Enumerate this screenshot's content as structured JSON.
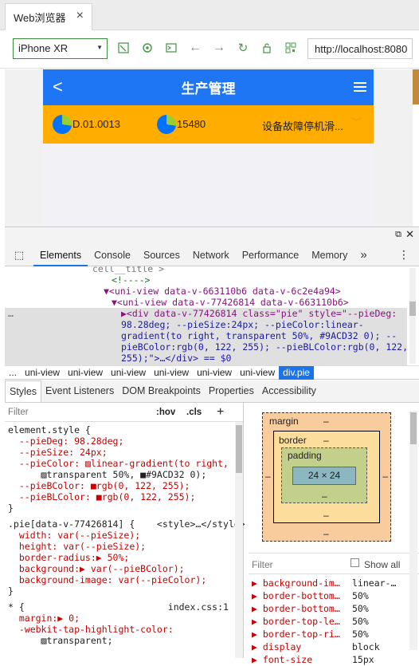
{
  "browser": {
    "tab_title": "Web浏览器",
    "tab_close": "×",
    "device": "iPhone XR",
    "url": "http://localhost:8080"
  },
  "app": {
    "header_title": "生产管理",
    "back_glyph": "<",
    "item1": "D.01.0013",
    "item2": "15480",
    "item3": "设备故障停机滑...",
    "colors": {
      "header": "#1e76f5",
      "bar": "#ffad00",
      "pie_blue": "#0072ff",
      "pie_green": "#9ACD32"
    }
  },
  "devtools": {
    "tabs": [
      "Elements",
      "Console",
      "Sources",
      "Network",
      "Performance",
      "Memory"
    ],
    "more_glyph": "»",
    "tree": [
      "cell__title >",
      "<!---->",
      "▼<uni-view data-v-663110b6 data-v-6c2e4a94>",
      "▼<uni-view data-v-77426814 data-v-663110b6>",
      "▶<div data-v-77426814 class=\"pie\" style=\"--pieDeg:",
      "98.28deg; --pieSize:24px; --pieColor:linear-",
      "gradient(to right, transparent 50%, #9ACD32 0); --",
      "pieBColor:rgb(0, 122, 255); --pieBLColor:rgb(0, 122,",
      "255);\">…</div> == $0"
    ],
    "ellipsis": "…",
    "breadcrumbs": [
      "...",
      "uni-view",
      "uni-view",
      "uni-view",
      "uni-view",
      "uni-view",
      "uni-view",
      "div.pie"
    ],
    "subtabs": [
      "Styles",
      "Event Listeners",
      "DOM Breakpoints",
      "Properties",
      "Accessibility"
    ],
    "filter_placeholder": "Filter",
    "hov": ":hov",
    ".cls": ".cls",
    "plus": "+",
    "styles": [
      {
        "text": "element.style {",
        "kind": "sel"
      },
      {
        "text": "  --pieDeg: 98.28deg;",
        "kind": "prop"
      },
      {
        "text": "  --pieSize: 24px;",
        "kind": "prop"
      },
      {
        "text": "  --pieColor: ▨linear-gradient(to right,",
        "kind": "prop"
      },
      {
        "text": "      ▨transparent 50%, ■#9ACD32 0);",
        "kind": "val"
      },
      {
        "text": "  --pieBColor: ■rgb(0, 122, 255);",
        "kind": "prop"
      },
      {
        "text": "  --pieBLColor: ■rgb(0, 122, 255);",
        "kind": "prop"
      },
      {
        "text": "}",
        "kind": "sel"
      },
      {
        "text": ".pie[data-v-77426814] {    <style>…</style>",
        "kind": "sel"
      },
      {
        "text": "  width: var(--pieSize);",
        "kind": "prop"
      },
      {
        "text": "  height: var(--pieSize);",
        "kind": "prop"
      },
      {
        "text": "  border-radius:▶ 50%;",
        "kind": "prop"
      },
      {
        "text": "  background:▶ var(--pieBColor);",
        "kind": "prop"
      },
      {
        "text": "  background-image: var(--pieColor);",
        "kind": "prop"
      },
      {
        "text": "}",
        "kind": "sel"
      },
      {
        "text": "* {                          index.css:1",
        "kind": "sel"
      },
      {
        "text": "  margin:▶ 0;",
        "kind": "prop"
      },
      {
        "text": "  -webkit-tap-highlight-color:",
        "kind": "prop"
      },
      {
        "text": "      ▨transparent;",
        "kind": "val"
      }
    ],
    "boxmodel": {
      "margin": "margin",
      "border": "border",
      "padding": "padding",
      "content": "24 × 24",
      "dash": "–"
    },
    "computed_filter": "Filter",
    "show_all": "Show all",
    "computed": [
      {
        "k": "▶ background-im…",
        "v": "linear-…"
      },
      {
        "k": "▶ border-bottom…",
        "v": "50%"
      },
      {
        "k": "▶ border-bottom…",
        "v": "50%"
      },
      {
        "k": "▶ border-top-le…",
        "v": "50%"
      },
      {
        "k": "▶ border-top-ri…",
        "v": "50%"
      },
      {
        "k": "▶ display",
        "v": "block"
      },
      {
        "k": "▶ font-size",
        "v": "15px"
      }
    ]
  }
}
